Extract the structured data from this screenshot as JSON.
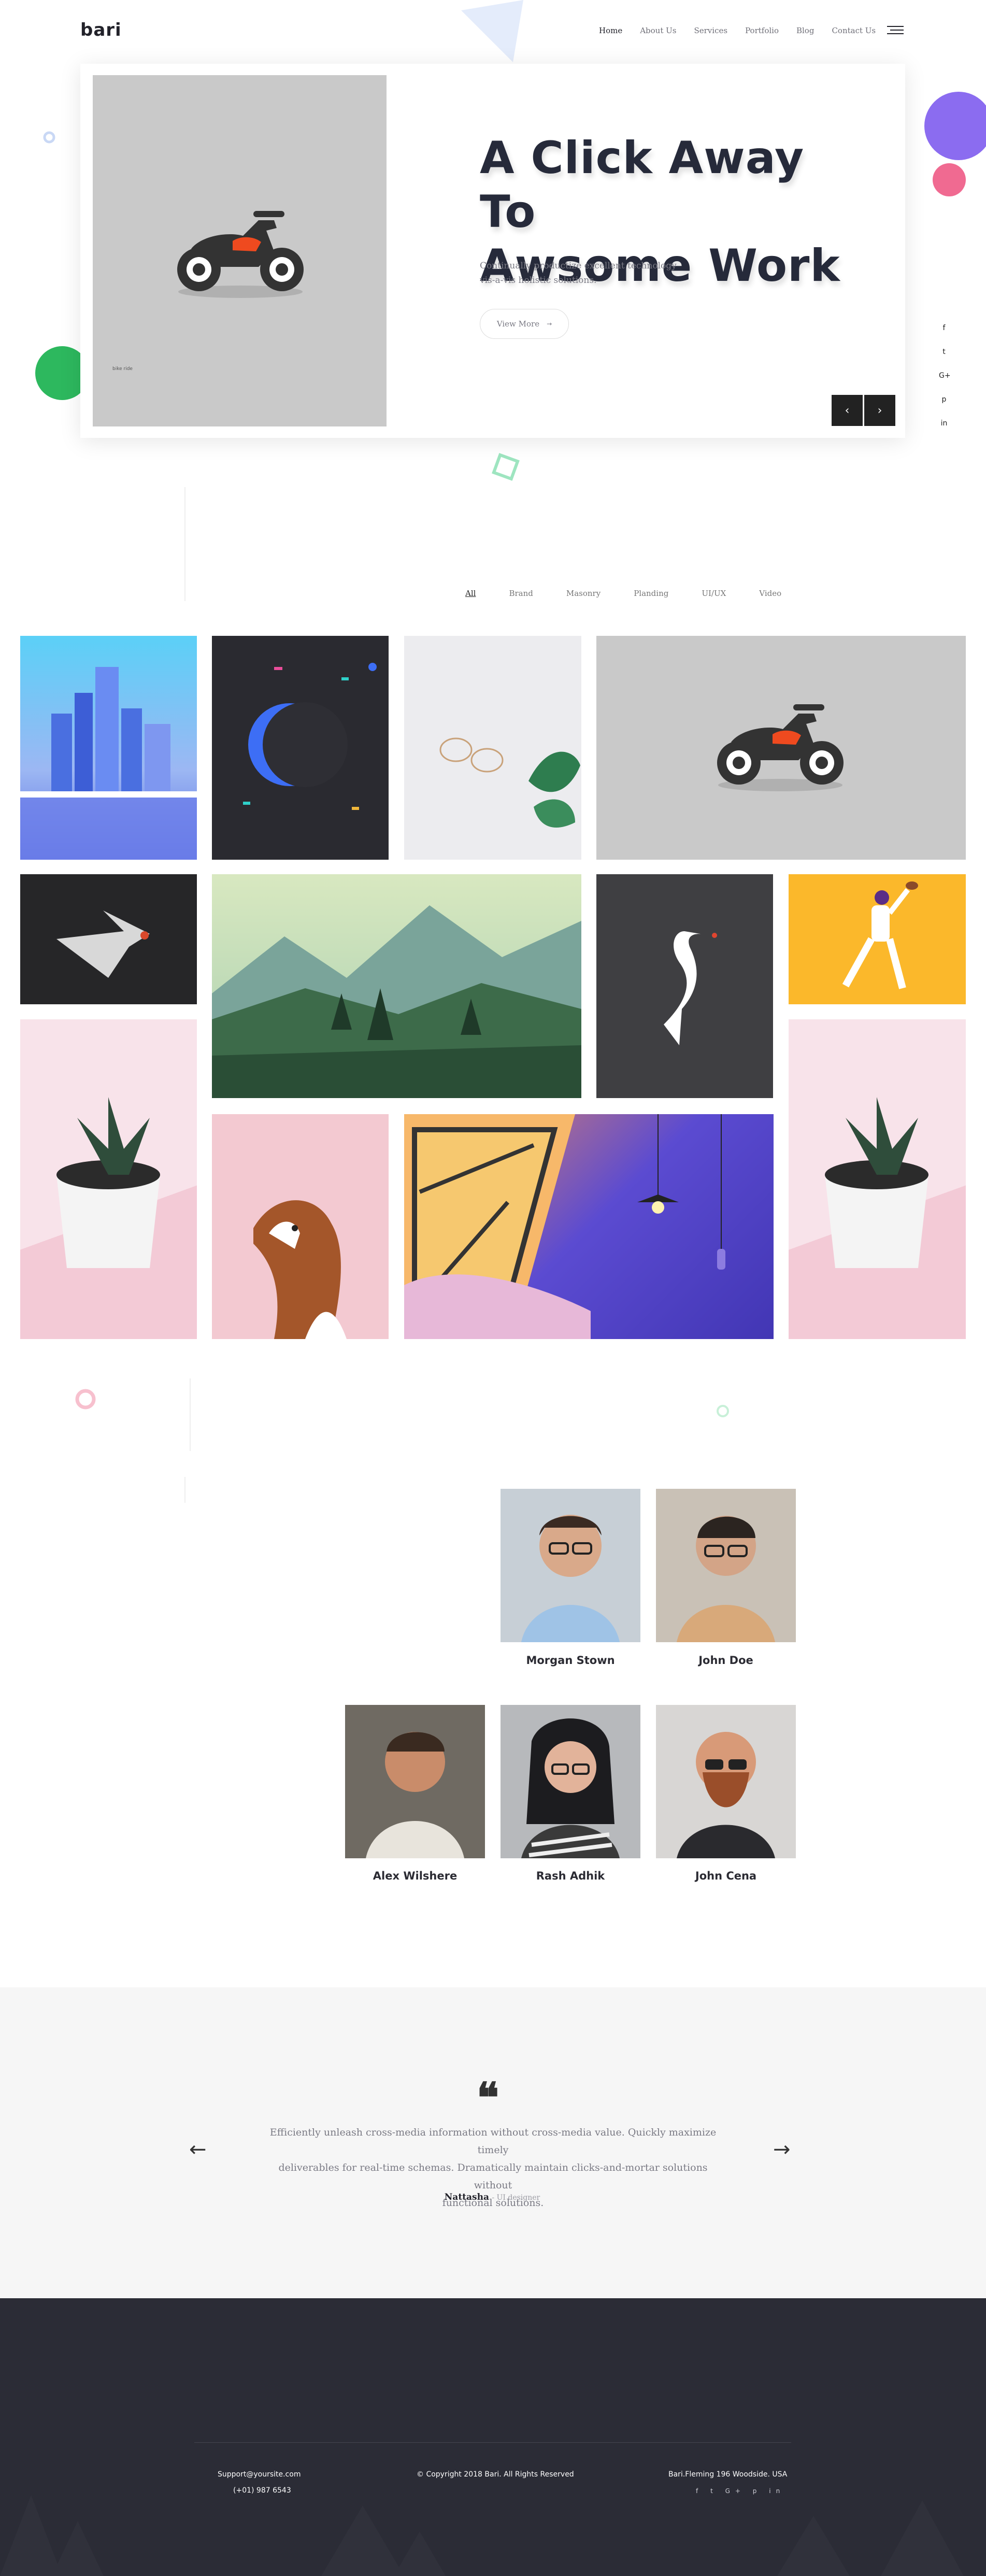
{
  "header": {
    "logo": "bari",
    "nav": [
      "Home",
      "About Us",
      "Services",
      "Portfolio",
      "Blog",
      "Contact Us"
    ]
  },
  "hero": {
    "title_line1": "A Click Away To",
    "title_line2": "Awsome Work",
    "desc_line1": "Continually productize excellent technology",
    "desc_line2": "vis-a-vis holistic solutions.",
    "button": "View More",
    "prev": "‹",
    "next": "›",
    "tag": "bike ride"
  },
  "social_side": [
    "f",
    "t",
    "G+",
    "p",
    "in"
  ],
  "portfolio": {
    "filters": [
      "All",
      "Brand",
      "Masonry",
      "Planding",
      "UI/UX",
      "Video"
    ]
  },
  "team": {
    "members": [
      "Morgan Stown",
      "John Doe",
      "Alex Wilshere",
      "Rash Adhik",
      "John Cena"
    ]
  },
  "testimonial": {
    "quote_mark": "❝",
    "text_line1": "Efficiently unleash cross-media information without cross-media value. Quickly maximize timely",
    "text_line2": "deliverables for real-time schemas. Dramatically maintain clicks-and-mortar solutions without",
    "text_line3": "functional solutions.",
    "author": "Nattasha",
    "role": "- UI designer",
    "prev": "←",
    "next": "→"
  },
  "footer": {
    "email": "Support@yoursite.com",
    "phone": "(+01) 987 6543",
    "copyright": "© Copyright 2018 Bari. All Rights Reserved",
    "address": "Bari.Fleming 196 Woodside. USA",
    "social": [
      "f",
      "t",
      "G+",
      "p",
      "in"
    ]
  }
}
